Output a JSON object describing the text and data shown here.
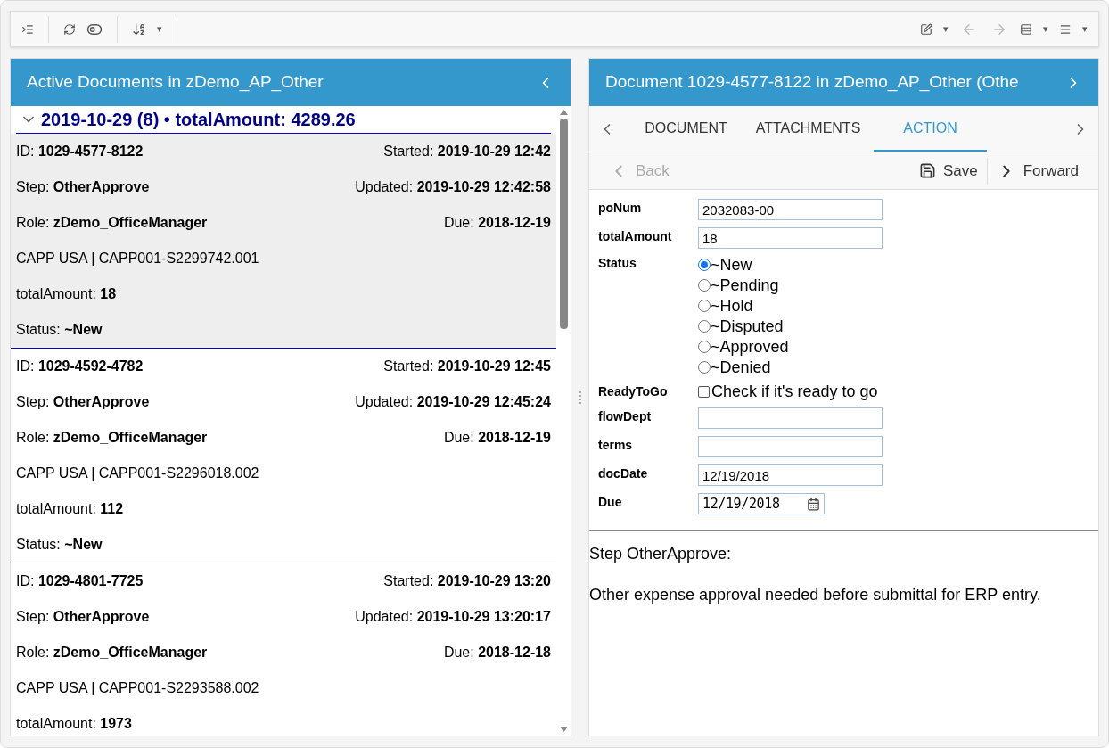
{
  "toolbar": {
    "sort_caret": "▾",
    "right_carets": [
      "▾",
      "▾",
      "▾"
    ]
  },
  "left_panel": {
    "title": "Active Documents in zDemo_AP_Other",
    "group": {
      "expanded": true,
      "heading": "2019-10-29 (8) • totalAmount: 4289.26"
    },
    "documents": [
      {
        "selected": true,
        "lines": [
          {
            "kind": "pair",
            "left": {
              "label": "ID:",
              "value": "1029-4577-8122"
            },
            "right": {
              "label": "Started:",
              "value": "2019-10-29 12:42"
            }
          },
          {
            "kind": "pair",
            "left": {
              "label": "Step:",
              "value": "OtherApprove"
            },
            "right": {
              "label": "Updated:",
              "value": "2019-10-29 12:42:58"
            }
          },
          {
            "kind": "pair",
            "left": {
              "label": "Role:",
              "value": "zDemo_OfficeManager"
            },
            "right": {
              "label": "Due:",
              "value": "2018-12-19"
            }
          },
          {
            "kind": "text",
            "text": "CAPP USA | CAPP001-S2299742.001"
          },
          {
            "kind": "single",
            "left": {
              "label": "totalAmount:",
              "value": "18"
            }
          },
          {
            "kind": "single",
            "left": {
              "label": "Status:",
              "value": "~New"
            }
          }
        ]
      },
      {
        "selected": false,
        "lines": [
          {
            "kind": "pair",
            "left": {
              "label": "ID:",
              "value": "1029-4592-4782"
            },
            "right": {
              "label": "Started:",
              "value": "2019-10-29 12:45"
            }
          },
          {
            "kind": "pair",
            "left": {
              "label": "Step:",
              "value": "OtherApprove"
            },
            "right": {
              "label": "Updated:",
              "value": "2019-10-29 12:45:24"
            }
          },
          {
            "kind": "pair",
            "left": {
              "label": "Role:",
              "value": "zDemo_OfficeManager"
            },
            "right": {
              "label": "Due:",
              "value": "2018-12-19"
            }
          },
          {
            "kind": "text",
            "text": "CAPP USA | CAPP001-S2296018.002"
          },
          {
            "kind": "single",
            "left": {
              "label": "totalAmount:",
              "value": "112"
            }
          },
          {
            "kind": "single",
            "left": {
              "label": "Status:",
              "value": "~New"
            }
          }
        ]
      },
      {
        "selected": false,
        "lines": [
          {
            "kind": "pair",
            "left": {
              "label": "ID:",
              "value": "1029-4801-7725"
            },
            "right": {
              "label": "Started:",
              "value": "2019-10-29 13:20"
            }
          },
          {
            "kind": "pair",
            "left": {
              "label": "Step:",
              "value": "OtherApprove"
            },
            "right": {
              "label": "Updated:",
              "value": "2019-10-29 13:20:17"
            }
          },
          {
            "kind": "pair",
            "left": {
              "label": "Role:",
              "value": "zDemo_OfficeManager"
            },
            "right": {
              "label": "Due:",
              "value": "2018-12-18"
            }
          },
          {
            "kind": "text",
            "text": "CAPP USA | CAPP001-S2293588.002"
          },
          {
            "kind": "single",
            "left": {
              "label": "totalAmount:",
              "value": "1973"
            }
          }
        ]
      }
    ]
  },
  "right_panel": {
    "title": "Document 1029-4577-8122 in zDemo_AP_Other (Othe",
    "tabs": [
      {
        "label": "DOCUMENT",
        "selected": false
      },
      {
        "label": "ATTACHMENTS",
        "selected": false
      },
      {
        "label": "ACTION",
        "selected": true
      }
    ],
    "actions": [
      {
        "kind": "back",
        "label": "Back",
        "disabled": true
      },
      {
        "kind": "save",
        "label": "Save",
        "disabled": false
      },
      {
        "kind": "forward",
        "label": "Forward",
        "disabled": false
      }
    ],
    "form": [
      {
        "kind": "text",
        "label": "poNum",
        "value": "2032083-00"
      },
      {
        "kind": "text",
        "label": "totalAmount",
        "value": "18"
      },
      {
        "kind": "radio",
        "label": "Status",
        "options": [
          {
            "label": "~New",
            "selected": true
          },
          {
            "label": "~Pending",
            "selected": false
          },
          {
            "label": "~Hold",
            "selected": false
          },
          {
            "label": "~Disputed",
            "selected": false
          },
          {
            "label": "~Approved",
            "selected": false
          },
          {
            "label": "~Denied",
            "selected": false
          }
        ]
      },
      {
        "kind": "checkbox",
        "label": "ReadyToGo",
        "text": "Check if it's ready to go",
        "checked": false
      },
      {
        "kind": "text",
        "label": "flowDept"
      },
      {
        "kind": "text",
        "label": "terms"
      },
      {
        "kind": "text",
        "label": "docDate",
        "value": "12/19/2018"
      },
      {
        "kind": "date",
        "label": "Due",
        "value": "12/19/2018"
      }
    ],
    "step_title": "Step OtherApprove:",
    "step_description": "Other expense approval needed before submittal for ERP entry."
  }
}
